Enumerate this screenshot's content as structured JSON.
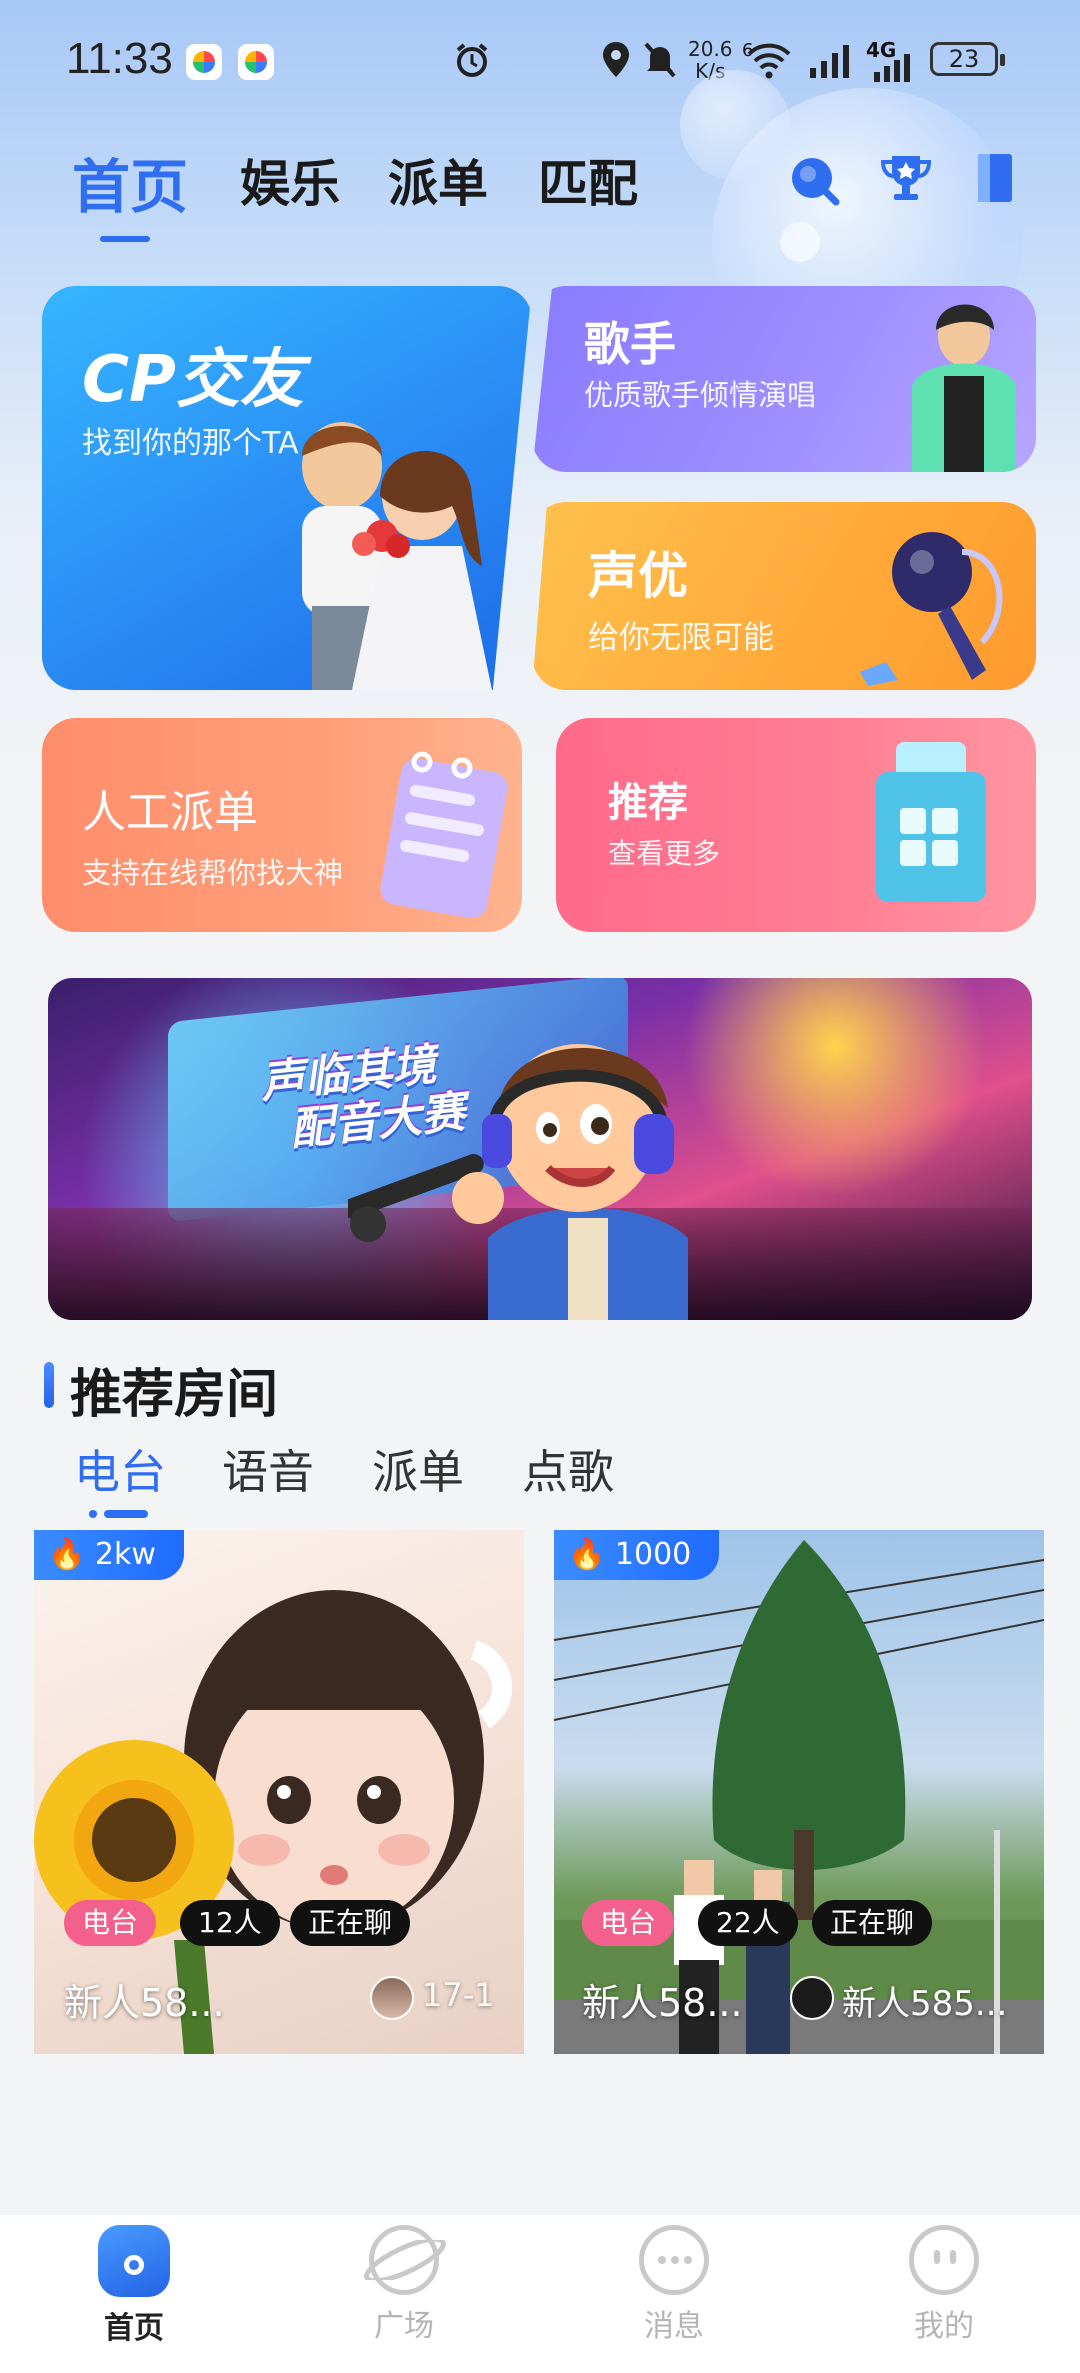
{
  "status": {
    "time": "11:33",
    "net_speed_value": "20.6",
    "net_speed_unit": "K/s",
    "wifi_label": "6",
    "network": "4G",
    "battery": "23"
  },
  "top_tabs": [
    {
      "label": "首页",
      "active": true
    },
    {
      "label": "娱乐",
      "active": false
    },
    {
      "label": "派单",
      "active": false
    },
    {
      "label": "匹配",
      "active": false
    }
  ],
  "top_icons": [
    "search-icon",
    "trophy-icon",
    "door-icon"
  ],
  "feature_cards": {
    "cp": {
      "title": "CP交友",
      "subtitle": "找到你的那个TA"
    },
    "singer": {
      "title": "歌手",
      "subtitle": "优质歌手倾情演唱"
    },
    "voice_actor": {
      "title": "声优",
      "subtitle": "给你无限可能"
    },
    "dispatch": {
      "title": "人工派单",
      "subtitle": "支持在线帮你找大神"
    },
    "recommend": {
      "title": "推荐",
      "subtitle": "查看更多"
    }
  },
  "banner": {
    "line1": "声临其境",
    "line2": "配音大赛"
  },
  "section": {
    "title": "推荐房间"
  },
  "sub_tabs": [
    {
      "label": "电台",
      "active": true
    },
    {
      "label": "语音",
      "active": false
    },
    {
      "label": "派单",
      "active": false
    },
    {
      "label": "点歌",
      "active": false
    }
  ],
  "rooms": [
    {
      "hot": "2kw",
      "category": "电台",
      "count": "12人",
      "status": "正在聊",
      "title": "新人58...",
      "owner": "17-1"
    },
    {
      "hot": "1000",
      "category": "电台",
      "count": "22人",
      "status": "正在聊",
      "title": "新人58...",
      "owner": "新人585..."
    }
  ],
  "bottom_nav": [
    {
      "label": "首页",
      "active": true
    },
    {
      "label": "广场",
      "active": false
    },
    {
      "label": "消息",
      "active": false
    },
    {
      "label": "我的",
      "active": false
    }
  ],
  "colors": {
    "accent": "#2f6ef0",
    "pink": "#f4608d"
  }
}
